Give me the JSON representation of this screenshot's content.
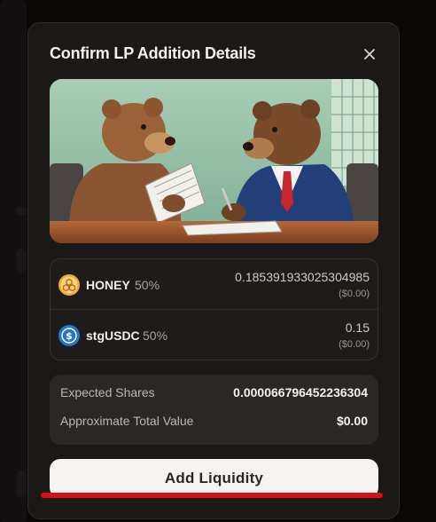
{
  "modal": {
    "title": "Confirm LP Addition Details",
    "close_icon": "close-icon"
  },
  "hero": {
    "description_icon": "two-bears-reviewing-documents-illustration"
  },
  "tokens": [
    {
      "symbol": "HONEY",
      "weight": "50%",
      "amount": "0.185391933025304985",
      "usd": "($0.00)",
      "icon": "honey-token-icon"
    },
    {
      "symbol": "stgUSDC",
      "weight": "50%",
      "amount": "0.15",
      "usd": "($0.00)",
      "icon": "usdc-token-icon"
    }
  ],
  "summary": {
    "expected_shares_label": "Expected Shares",
    "expected_shares_value": "0.000066796452236304",
    "approx_value_label": "Approximate Total Value",
    "approx_value_value": "$0.00"
  },
  "cta": {
    "label": "Add Liquidity"
  },
  "colors": {
    "accent_underline": "#d80f0f",
    "honey": "#f0a83a",
    "usdc": "#2775ca"
  }
}
